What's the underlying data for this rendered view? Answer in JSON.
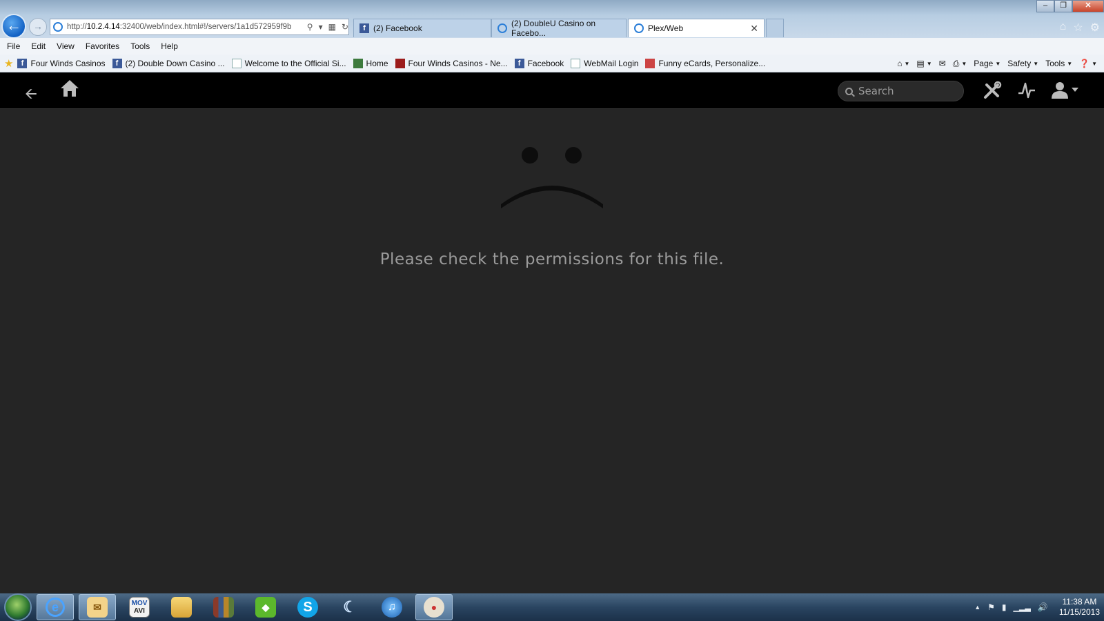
{
  "browser": {
    "address": {
      "url_prefix": "http://",
      "url_host": "10.2.4.14",
      "url_rest": ":32400/web/index.html#!/servers/1a1d572959f9b"
    },
    "tabs": [
      {
        "label": "(2) Facebook"
      },
      {
        "label": "(2) DoubleU Casino on Facebo..."
      },
      {
        "label": "Plex/Web"
      }
    ],
    "menu": [
      "File",
      "Edit",
      "View",
      "Favorites",
      "Tools",
      "Help"
    ],
    "favorites": [
      {
        "label": "Four Winds Casinos",
        "icon": "facebook-icon"
      },
      {
        "label": "(2) Double Down Casino ...",
        "icon": "facebook-icon"
      },
      {
        "label": "Welcome to the Official Si...",
        "icon": "page-icon"
      },
      {
        "label": "Home",
        "icon": "home-icon"
      },
      {
        "label": "Four Winds Casinos - Ne...",
        "icon": "w-icon"
      },
      {
        "label": "Facebook",
        "icon": "facebook-icon"
      },
      {
        "label": "WebMail Login",
        "icon": "page-icon"
      },
      {
        "label": "Funny eCards, Personalize...",
        "icon": "ecard-icon"
      }
    ],
    "command_bar": {
      "page": "Page",
      "safety": "Safety",
      "tools": "Tools"
    }
  },
  "plex": {
    "search_placeholder": "Search",
    "error_message": "Please check the permissions for this file."
  },
  "taskbar": {
    "time": "11:38 AM",
    "date": "11/15/2013",
    "movavi_label_top": "MOV",
    "movavi_label_bottom": "AVI"
  },
  "colors": {
    "plex_bg": "#252525",
    "plex_header": "#000000",
    "error_text": "#9b9b9b",
    "ie_blue": "#1261c4"
  }
}
